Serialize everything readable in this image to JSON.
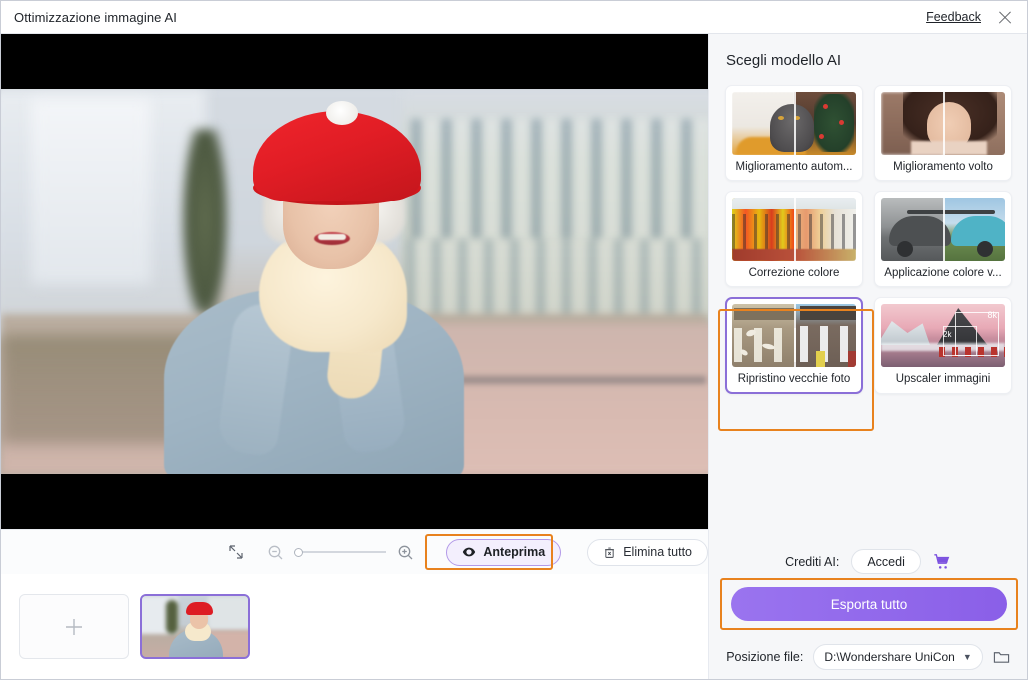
{
  "window": {
    "title": "Ottimizzazione immagine AI",
    "feedback_label": "Feedback",
    "close_icon": "close-icon"
  },
  "preview": {
    "stage_background": "#000000",
    "photo_description": "Anziana sorridente con berretto rosso e cappotto azzurro"
  },
  "toolbar": {
    "fit_icon": "fit-to-screen-icon",
    "zoom_out_icon": "zoom-out-icon",
    "zoom_in_icon": "zoom-in-icon",
    "slider_value": 0,
    "preview_label": "Anteprima",
    "preview_icon": "eye-icon",
    "delete_all_label": "Elimina tutto",
    "delete_all_icon": "trash-icon",
    "preview_highlighted": true,
    "highlight_color": "#e8821e"
  },
  "thumbstrip": {
    "add_label": "+",
    "add_icon": "plus-icon",
    "items": [
      {
        "name": "anziana-berretto-rosso",
        "selected": true
      }
    ]
  },
  "right_panel": {
    "title": "Scegli modello AI",
    "models": [
      {
        "label": "Miglioramento autom...",
        "art": "auto",
        "selected": false
      },
      {
        "label": "Miglioramento volto",
        "art": "face",
        "selected": false
      },
      {
        "label": "Correzione colore",
        "art": "color",
        "selected": false
      },
      {
        "label": "Applicazione colore v...",
        "art": "car",
        "selected": false
      },
      {
        "label": "Ripristino vecchie foto",
        "art": "old",
        "selected": true
      },
      {
        "label": "Upscaler immagini",
        "art": "upscale",
        "selected": false
      }
    ],
    "upscaler_badges": {
      "low": "2k",
      "high": "8k"
    },
    "credits_label": "Crediti AI:",
    "login_label": "Accedi",
    "cart_icon": "shopping-cart-icon",
    "export_label": "Esporta tutto",
    "export_highlighted": true,
    "file_location_label": "Posizione file:",
    "file_location_value": "D:\\Wondershare UniCon",
    "folder_icon": "folder-icon",
    "selected_border_color": "#8b6fd8",
    "accent_color": "#8a5fe8"
  }
}
